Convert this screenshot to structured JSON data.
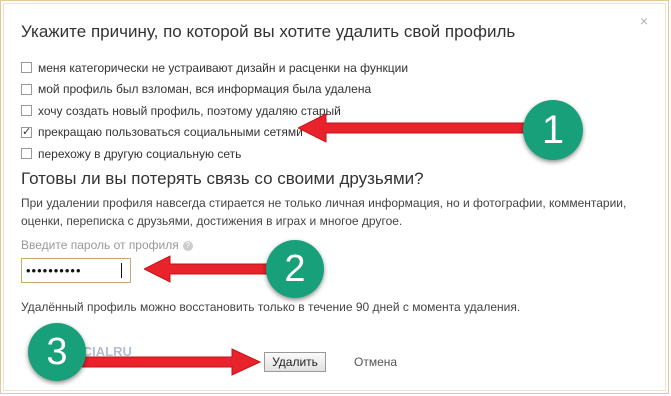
{
  "dialog": {
    "close_symbol": "×",
    "title": "Укажите причину, по которой вы хотите удалить свой профиль",
    "reasons": [
      {
        "label": "меня категорически не устраивают дизайн и расценки на функции",
        "checked": false
      },
      {
        "label": "мой профиль был взломан, вся информация была удалена",
        "checked": false
      },
      {
        "label": "хочу создать новый профиль, поэтому удаляю старый",
        "checked": false
      },
      {
        "label": "прекращаю пользоваться социальными сетями",
        "checked": true
      },
      {
        "label": "перехожу в другую социальную сеть",
        "checked": false
      }
    ],
    "friends_heading": "Готовы ли вы потерять связь со своими друзьями?",
    "info_text": "При удалении профиля навсегда стирается не только личная информация, но и фотографии, комментарии, оценки, переписка с друзьями, достижения в играх и многое другое.",
    "password_label": "Введите пароль от профиля",
    "password_help_icon": "?",
    "password_value": "••••••••••",
    "restore_note": "Удалённый профиль можно восстановить только в течение 90 дней с момента удаления.",
    "delete_button": "Удалить",
    "cancel_link": "Отмена"
  },
  "annotations": {
    "badges": [
      "1",
      "2",
      "3"
    ],
    "arrow_color": "#e8232b",
    "badge_color": "#17a07a"
  },
  "watermark": "SOCIALRU"
}
